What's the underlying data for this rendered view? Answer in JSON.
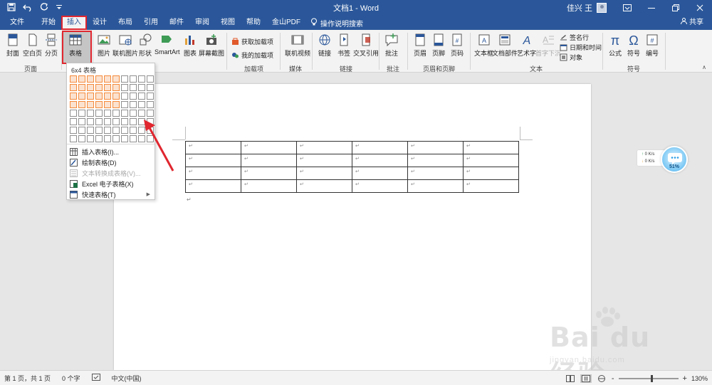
{
  "titlebar": {
    "title": "文档1 - Word",
    "user": "佳兴 王",
    "qat_icons": [
      "save-icon",
      "undo-icon",
      "redo-icon",
      "customize-icon"
    ],
    "window_buttons": [
      "ribbon-options-icon",
      "minimize-icon",
      "restore-icon",
      "close-icon"
    ]
  },
  "tabs": {
    "items": [
      {
        "label": "文件"
      },
      {
        "label": "开始"
      },
      {
        "label": "插入"
      },
      {
        "label": "设计"
      },
      {
        "label": "布局"
      },
      {
        "label": "引用"
      },
      {
        "label": "邮件"
      },
      {
        "label": "审阅"
      },
      {
        "label": "视图"
      },
      {
        "label": "帮助"
      },
      {
        "label": "金山PDF"
      }
    ],
    "active": "插入",
    "search_label": "操作说明搜索",
    "share_label": "共享"
  },
  "ribbon": {
    "pages": {
      "cover": "封面",
      "blank": "空白页",
      "break": "分页",
      "group": "页面"
    },
    "table": {
      "label": "表格",
      "group": "表格"
    },
    "illustrations": {
      "picture": "图片",
      "online_picture": "联机图片",
      "shapes": "形状",
      "smartart": "SmartArt",
      "chart": "图表",
      "screenshot": "屏幕截图",
      "group_partial": "插图"
    },
    "addins": {
      "get": "获取加载项",
      "mine": "我的加载项",
      "group": "加载项"
    },
    "media": {
      "online_video": "联机视频",
      "group": "媒体"
    },
    "links": {
      "link": "链接",
      "bookmark": "书签",
      "crossref": "交叉引用",
      "group": "链接"
    },
    "comments": {
      "comment": "批注",
      "group": "批注"
    },
    "header_footer": {
      "header": "页眉",
      "footer": "页脚",
      "page_number": "页码",
      "group": "页眉和页脚"
    },
    "text": {
      "textbox": "文本框",
      "quickparts": "文档部件",
      "wordart": "艺术字",
      "dropcap": "首字下沉",
      "signature": "签名行",
      "datetime": "日期和时间",
      "object": "对象",
      "group": "文本"
    },
    "symbols": {
      "equation": "公式",
      "symbol": "符号",
      "number": "编号",
      "group": "符号"
    }
  },
  "table_menu": {
    "title": "6x4 表格",
    "cols": 10,
    "rows": 8,
    "sel_cols": 6,
    "sel_rows": 4,
    "items": [
      {
        "label": "插入表格(I)...",
        "icon": "insert-table-icon",
        "disabled": false
      },
      {
        "label": "绘制表格(D)",
        "icon": "draw-table-icon",
        "disabled": false
      },
      {
        "label": "文本转换成表格(V)...",
        "icon": "text-to-table-icon",
        "disabled": true
      },
      {
        "label": "Excel 电子表格(X)",
        "icon": "excel-icon",
        "disabled": false
      },
      {
        "label": "快速表格(T)",
        "icon": "quick-table-icon",
        "disabled": false,
        "submenu": true
      }
    ]
  },
  "document": {
    "table_cols": 6,
    "table_rows": 4,
    "cell_mark": "↵"
  },
  "net_widget": {
    "up": "0  K/s",
    "down": "0  K/s",
    "percent": "51%"
  },
  "watermark": {
    "brand": "Bai du 经验",
    "url": "jingyan.baidu.com"
  },
  "statusbar": {
    "page": "第 1 页，共 1 页",
    "words": "0 个字",
    "language": "中文(中国)",
    "zoom": "130%",
    "zoom_out": "-",
    "zoom_in": "+"
  },
  "colors": {
    "word_blue": "#2b579a",
    "highlight_red": "#e0262f",
    "grid_select": "#f58a3b"
  }
}
